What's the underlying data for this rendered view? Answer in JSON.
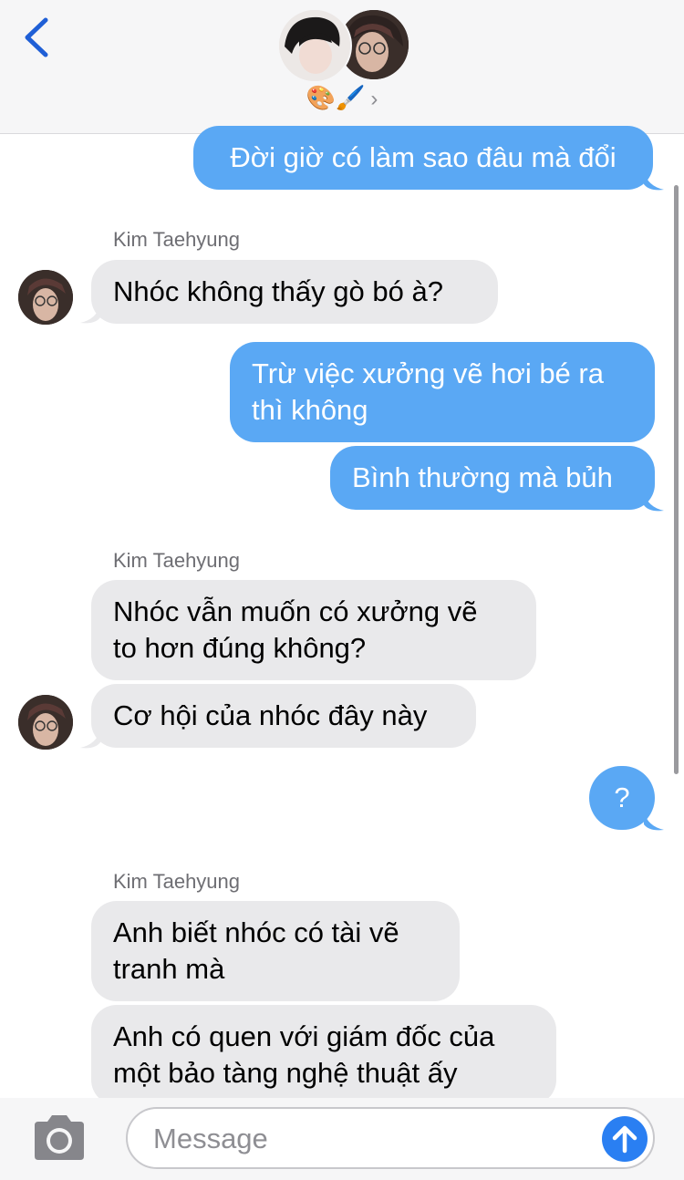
{
  "header": {
    "group_name": "🎨🖌️",
    "chevron": "›"
  },
  "messages": [
    {
      "kind": "out",
      "text": "Đời giờ có làm sao đâu mà đổi"
    },
    {
      "kind": "sender",
      "text": "Kim Taehyung"
    },
    {
      "kind": "in",
      "text": "Nhóc không thấy gò bó à?"
    },
    {
      "kind": "out",
      "line1": "Trừ việc xưởng vẽ hơi bé ra",
      "line2": "thì không"
    },
    {
      "kind": "out",
      "text": "Bình thường mà bủh"
    },
    {
      "kind": "sender",
      "text": "Kim Taehyung"
    },
    {
      "kind": "in",
      "line1": "Nhóc vẫn muốn có xưởng vẽ",
      "line2": "to hơn đúng không?"
    },
    {
      "kind": "in",
      "text": "Cơ hội của nhóc đây này"
    },
    {
      "kind": "out",
      "text": "?"
    },
    {
      "kind": "sender",
      "text": "Kim Taehyung"
    },
    {
      "kind": "in",
      "line1": "Anh biết nhóc có tài vẽ",
      "line2": "tranh mà"
    },
    {
      "kind": "in",
      "line1": "Anh có quen với giám đốc của",
      "line2": "một bảo tàng nghệ thuật ấy"
    }
  ],
  "composer": {
    "placeholder": "Message",
    "value": ""
  },
  "colors": {
    "outgoing": "#5aa8f4",
    "incoming": "#e9e9eb",
    "accent": "#2a7ff2",
    "back": "#1f5fd6"
  },
  "icons": [
    "back-chevron-icon",
    "camera-icon",
    "send-arrow-icon"
  ]
}
